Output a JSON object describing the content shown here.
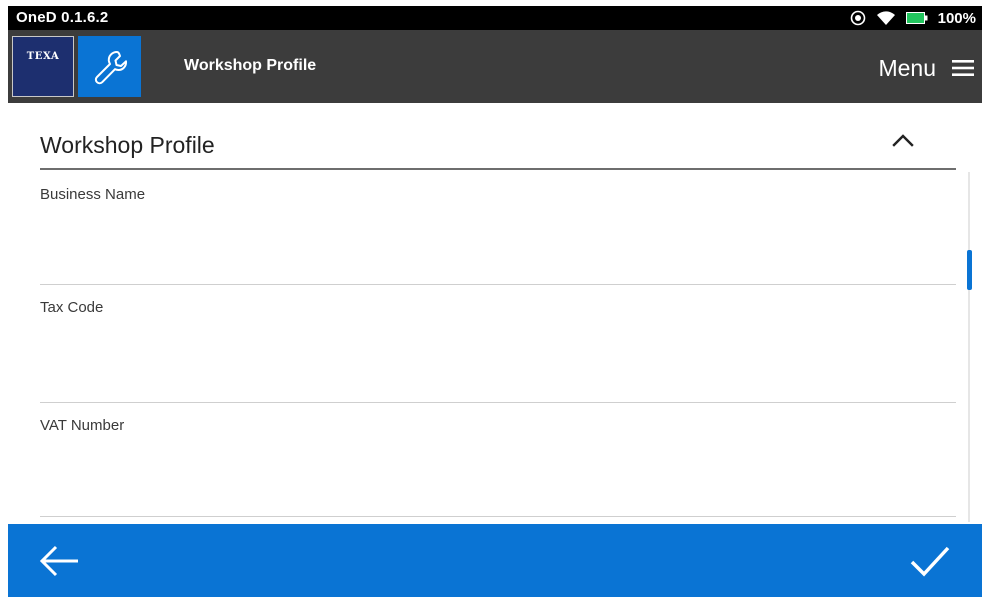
{
  "status_bar": {
    "app_version": "OneD 0.1.6.2",
    "battery_percent": "100%",
    "icons": [
      "location-icon",
      "wifi-icon",
      "battery-icon"
    ]
  },
  "header": {
    "logo_text": "TEXA",
    "tool_icon": "wrench-icon",
    "title": "Workshop Profile",
    "menu_label": "Menu",
    "menu_icon": "hamburger-icon"
  },
  "section": {
    "title": "Workshop Profile",
    "toggle_icon": "chevron-up-icon"
  },
  "fields": [
    {
      "label": "Business Name",
      "value": ""
    },
    {
      "label": "Tax Code",
      "value": ""
    },
    {
      "label": "VAT Number",
      "value": ""
    }
  ],
  "bottom_bar": {
    "back_icon": "arrow-left-icon",
    "confirm_icon": "checkmark-icon"
  },
  "colors": {
    "accent": "#0a74d4",
    "header_bg": "#3c3c3c",
    "status_bg": "#000000",
    "logo_bg": "#1d2f6f",
    "battery_green": "#22c55e"
  }
}
